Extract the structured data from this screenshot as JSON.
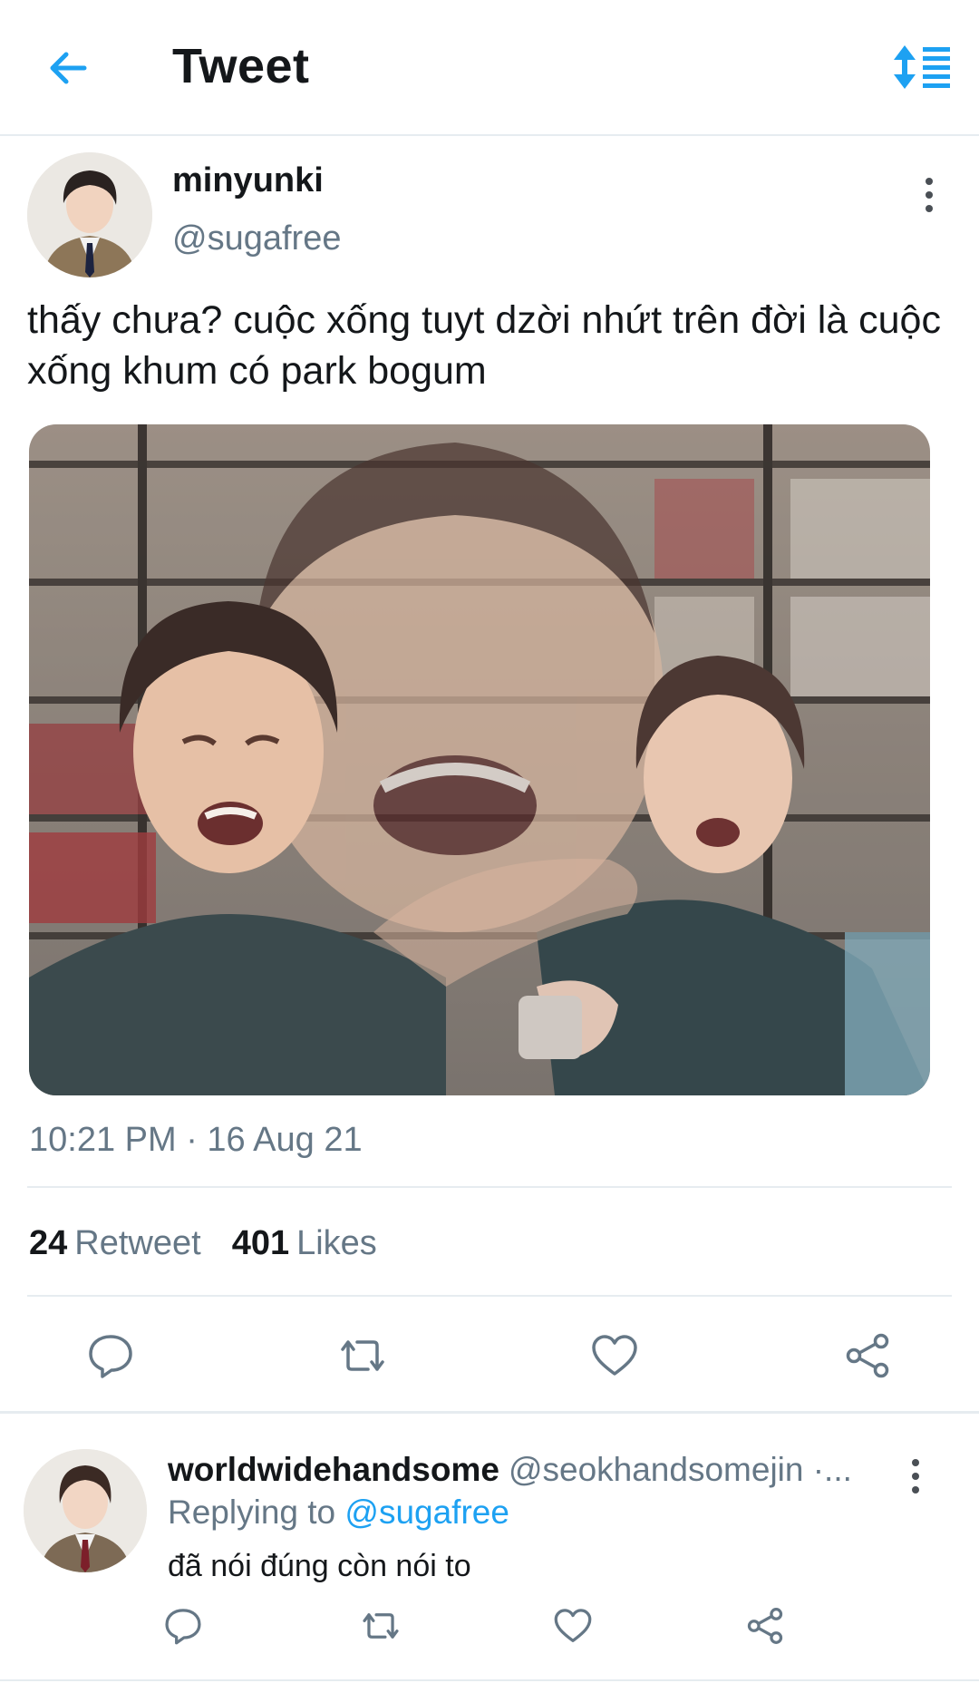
{
  "header": {
    "title": "Tweet",
    "back_icon": "arrow-left-icon",
    "sort_icon": "sort-list-icon",
    "accent": "#1da1f2"
  },
  "tweet": {
    "author_name": "minyunki",
    "author_handle": "@sugafree",
    "text": "thấy chưa? cuộc xống tuyt dzời nhứt trên đời là cuộc xống khum có park bogum",
    "media_description": "collage-image",
    "timestamp": "10:21 PM · 16 Aug 21",
    "retweets_count": "24",
    "retweets_label": "Retweet",
    "likes_count": "401",
    "likes_label": "Likes",
    "actions": [
      "reply-icon",
      "retweet-icon",
      "heart-icon",
      "share-icon"
    ]
  },
  "reply": {
    "author_name": "worldwidehandsome",
    "author_handle": "@seokhandsomejin ·...",
    "replying_prefix": "Replying to",
    "replying_handle": "@sugafree",
    "text": "đã nói đúng còn nói to"
  },
  "colors": {
    "text_primary": "#14171a",
    "text_secondary": "#657786",
    "link": "#1da1f2",
    "divider": "#e6ecf0"
  }
}
